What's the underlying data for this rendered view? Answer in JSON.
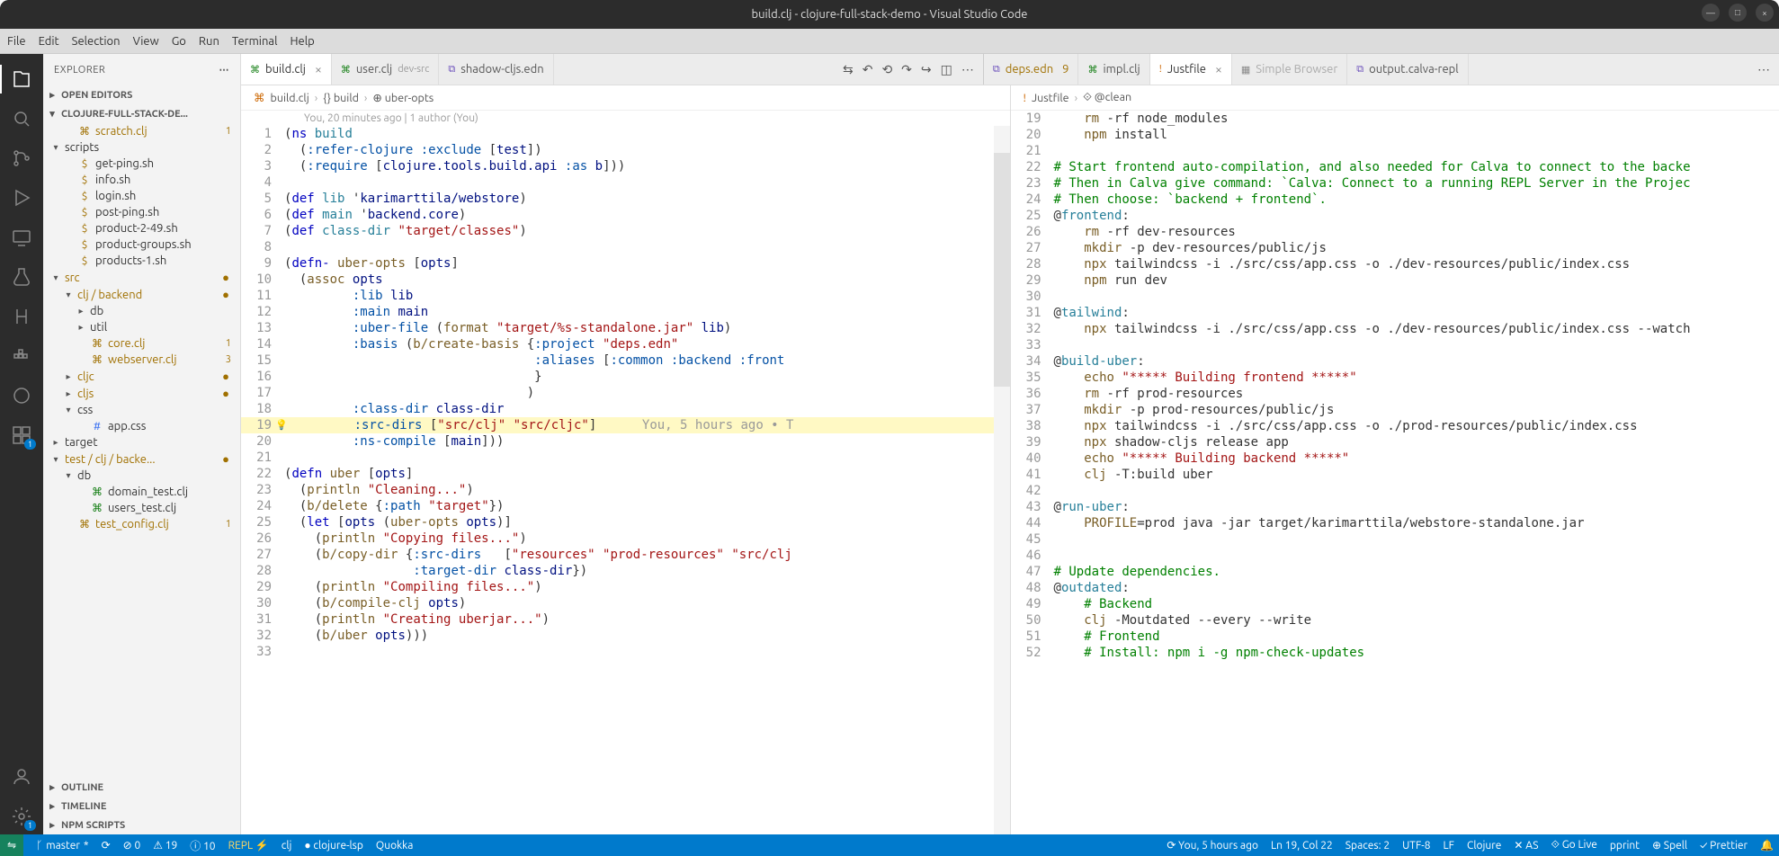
{
  "window": {
    "title": "build.clj - clojure-full-stack-demo - Visual Studio Code"
  },
  "menu": [
    "File",
    "Edit",
    "Selection",
    "View",
    "Go",
    "Run",
    "Terminal",
    "Help"
  ],
  "sidebar": {
    "title": "EXPLORER",
    "sections": {
      "open_editors": "OPEN EDITORS",
      "project": "CLOJURE-FULL-STACK-DE...",
      "outline": "OUTLINE",
      "timeline": "TIMELINE",
      "npm": "NPM SCRIPTS"
    },
    "tree": [
      {
        "depth": 1,
        "chev": "",
        "icon": "⌘",
        "iconColor": "#a07000",
        "label": "scratch.clj",
        "class": "gold",
        "badge": "1"
      },
      {
        "depth": 0,
        "chev": "▾",
        "icon": "",
        "label": "scripts"
      },
      {
        "depth": 1,
        "chev": "",
        "icon": "$",
        "iconColor": "#a07000",
        "label": "get-ping.sh"
      },
      {
        "depth": 1,
        "chev": "",
        "icon": "$",
        "iconColor": "#a07000",
        "label": "info.sh"
      },
      {
        "depth": 1,
        "chev": "",
        "icon": "$",
        "iconColor": "#a07000",
        "label": "login.sh"
      },
      {
        "depth": 1,
        "chev": "",
        "icon": "$",
        "iconColor": "#a07000",
        "label": "post-ping.sh"
      },
      {
        "depth": 1,
        "chev": "",
        "icon": "$",
        "iconColor": "#a07000",
        "label": "product-2-49.sh"
      },
      {
        "depth": 1,
        "chev": "",
        "icon": "$",
        "iconColor": "#a07000",
        "label": "product-groups.sh"
      },
      {
        "depth": 1,
        "chev": "",
        "icon": "$",
        "iconColor": "#a07000",
        "label": "products-1.sh"
      },
      {
        "depth": 0,
        "chev": "▾",
        "icon": "",
        "label": "src",
        "dot": "●",
        "class": "gold"
      },
      {
        "depth": 1,
        "chev": "▾",
        "icon": "",
        "label": "clj / backend",
        "dot": "●",
        "class": "gold"
      },
      {
        "depth": 2,
        "chev": "▸",
        "icon": "",
        "label": "db"
      },
      {
        "depth": 2,
        "chev": "▸",
        "icon": "",
        "label": "util"
      },
      {
        "depth": 2,
        "chev": "",
        "icon": "⌘",
        "iconColor": "#a07000",
        "label": "core.clj",
        "class": "gold",
        "badge": "1"
      },
      {
        "depth": 2,
        "chev": "",
        "icon": "⌘",
        "iconColor": "#a07000",
        "label": "webserver.clj",
        "class": "gold",
        "badge": "3"
      },
      {
        "depth": 1,
        "chev": "▸",
        "icon": "",
        "label": "cljc",
        "dot": "●",
        "class": "gold"
      },
      {
        "depth": 1,
        "chev": "▸",
        "icon": "",
        "label": "cljs",
        "dot": "●",
        "class": "gold"
      },
      {
        "depth": 1,
        "chev": "▾",
        "icon": "",
        "label": "css"
      },
      {
        "depth": 2,
        "chev": "",
        "icon": "#",
        "iconColor": "#2965f1",
        "label": "app.css"
      },
      {
        "depth": 0,
        "chev": "▸",
        "icon": "",
        "label": "target"
      },
      {
        "depth": 0,
        "chev": "▾",
        "icon": "",
        "label": "test / clj / backe...",
        "dot": "●",
        "class": "gold"
      },
      {
        "depth": 1,
        "chev": "▾",
        "icon": "",
        "label": "db"
      },
      {
        "depth": 2,
        "chev": "",
        "icon": "⌘",
        "iconColor": "#107c10",
        "label": "domain_test.clj"
      },
      {
        "depth": 2,
        "chev": "",
        "icon": "⌘",
        "iconColor": "#107c10",
        "label": "users_test.clj"
      },
      {
        "depth": 1,
        "chev": "",
        "icon": "⌘",
        "iconColor": "#a07000",
        "label": "test_config.clj",
        "class": "gold",
        "badge": "1"
      }
    ]
  },
  "tabsLeft": [
    {
      "icon": "⌘",
      "iconColor": "#107c10",
      "label": "build.clj",
      "active": true,
      "close": "×"
    },
    {
      "icon": "⌘",
      "iconColor": "#107c10",
      "label": "user.clj",
      "suffix": "dev-src"
    },
    {
      "icon": "⧉",
      "iconColor": "#6b4fbb",
      "label": "shadow-cljs.edn"
    }
  ],
  "tabsRight": [
    {
      "icon": "⧉",
      "iconColor": "#6b4fbb",
      "label": "deps.edn",
      "badge": "9",
      "class": "gold"
    },
    {
      "icon": "⌘",
      "iconColor": "#107c10",
      "label": "impl.clj"
    },
    {
      "icon": "!",
      "iconColor": "#cc6600",
      "label": "Justfile",
      "active": true,
      "close": "×"
    },
    {
      "icon": "▦",
      "iconColor": "#888",
      "label": "Simple Browser",
      "dim": true
    },
    {
      "icon": "⧉",
      "iconColor": "#6b4fbb",
      "label": "output.calva-repl"
    }
  ],
  "breadcrumbLeft": [
    "build.clj",
    "{} build",
    "⊕ uber-opts"
  ],
  "breadcrumbRight": [
    "Justfile",
    "⟐ @clean"
  ],
  "blame": "You, 20 minutes ago | 1 author (You)",
  "editorLeft": [
    {
      "n": 1,
      "t": "(<kw>ns</kw> <def>build</def>"
    },
    {
      "n": 2,
      "t": "  (<key>:refer-clojure</key> <key>:exclude</key> [<sym>test</sym>])"
    },
    {
      "n": 3,
      "t": "  (<key>:require</key> [<sym>clojure.tools.build.api</sym> <key>:as</key> <sym>b</sym>]))"
    },
    {
      "n": 4,
      "t": ""
    },
    {
      "n": 5,
      "t": "(<kw>def</kw> <def>lib</def> '<sym>karimarttila/webstore</sym>)"
    },
    {
      "n": 6,
      "t": "(<kw>def</kw> <def>main</def> '<sym>backend.core</sym>)"
    },
    {
      "n": 7,
      "t": "(<kw>def</kw> <def>class-dir</def> <str>\"target/classes\"</str>)"
    },
    {
      "n": 8,
      "t": ""
    },
    {
      "n": 9,
      "t": "(<kw>defn-</kw> <fn>uber-opts</fn> [<sym>opts</sym>]"
    },
    {
      "n": 10,
      "t": "  (<fn>assoc</fn> <sym>opts</sym>"
    },
    {
      "n": 11,
      "t": "         <key>:lib</key> <sym>lib</sym>"
    },
    {
      "n": 12,
      "t": "         <key>:main</key> <sym>main</sym>"
    },
    {
      "n": 13,
      "t": "         <key>:uber-file</key> (<fn>format</fn> <str>\"target/%s-standalone.jar\"</str> <sym>lib</sym>)"
    },
    {
      "n": 14,
      "t": "         <key>:basis</key> (<fn>b/create-basis</fn> {<key>:project</key> <str>\"deps.edn\"</str>"
    },
    {
      "n": 15,
      "t": "                                 <key>:aliases</key> [<key>:common</key> <key>:backend</key> <key>:front</key>"
    },
    {
      "n": 16,
      "t": "                                 }"
    },
    {
      "n": 17,
      "t": "                                )"
    },
    {
      "n": 18,
      "t": "         <key>:class-dir</key> <sym>class-dir</sym>"
    },
    {
      "n": 19,
      "hl": true,
      "bulb": true,
      "t": "         <key>:src-dirs</key> [<str>\"src/clj\"</str> <str>\"src/cljc\"</str>]      <ann>You, 5 hours ago • T</ann>"
    },
    {
      "n": 20,
      "t": "         <key>:ns-compile</key> [<sym>main</sym>]))"
    },
    {
      "n": 21,
      "t": ""
    },
    {
      "n": 22,
      "t": "(<kw>defn</kw> <fn>uber</fn> [<sym>opts</sym>]"
    },
    {
      "n": 23,
      "t": "  (<fn>println</fn> <str>\"Cleaning...\"</str>)"
    },
    {
      "n": 24,
      "t": "  (<fn>b/delete</fn> {<key>:path</key> <str>\"target\"</str>})"
    },
    {
      "n": 25,
      "t": "  (<kw>let</kw> [<sym>opts</sym> (<fn>uber-opts</fn> <sym>opts</sym>)]"
    },
    {
      "n": 26,
      "t": "    (<fn>println</fn> <str>\"Copying files...\"</str>)"
    },
    {
      "n": 27,
      "t": "    (<fn>b/copy-dir</fn> {<key>:src-dirs</key>   [<str>\"resources\"</str> <str>\"prod-resources\"</str> <str>\"src/clj</str>"
    },
    {
      "n": 28,
      "t": "                 <key>:target-dir</key> <sym>class-dir</sym>})"
    },
    {
      "n": 29,
      "t": "    (<fn>println</fn> <str>\"Compiling files...\"</str>)"
    },
    {
      "n": 30,
      "t": "    (<fn>b/compile-clj</fn> <sym>opts</sym>)"
    },
    {
      "n": 31,
      "t": "    (<fn>println</fn> <str>\"Creating uberjar...\"</str>)"
    },
    {
      "n": 32,
      "t": "    (<fn>b/uber</fn> <sym>opts</sym>)))"
    },
    {
      "n": 33,
      "t": ""
    }
  ],
  "editorRight": [
    {
      "n": 19,
      "t": "    <fn>rm</fn> -rf node_modules"
    },
    {
      "n": 20,
      "t": "    <fn>npm</fn> install"
    },
    {
      "n": 21,
      "t": ""
    },
    {
      "n": 22,
      "t": "<com># Start frontend auto-compilation, and also needed for Calva to connect to the backe</com>"
    },
    {
      "n": 23,
      "t": "<com># Then in Calva give command: `Calva: Connect to a running REPL Server in the Projec</com>"
    },
    {
      "n": 24,
      "t": "<com># Then choose: `backend + frontend`.</com>"
    },
    {
      "n": 25,
      "t": "@<def>frontend</def>:"
    },
    {
      "n": 26,
      "t": "    <fn>rm</fn> -rf dev-resources"
    },
    {
      "n": 27,
      "t": "    <fn>mkdir</fn> -p dev-resources/public/js"
    },
    {
      "n": 28,
      "t": "    <fn>npx</fn> tailwindcss -i ./src/css/app.css -o ./dev-resources/public/index.css"
    },
    {
      "n": 29,
      "t": "    <fn>npm</fn> run dev"
    },
    {
      "n": 30,
      "t": ""
    },
    {
      "n": 31,
      "t": "@<def>tailwind</def>:"
    },
    {
      "n": 32,
      "t": "    <fn>npx</fn> tailwindcss -i ./src/css/app.css -o ./dev-resources/public/index.css --watch"
    },
    {
      "n": 33,
      "t": ""
    },
    {
      "n": 34,
      "t": "@<def>build-uber</def>:"
    },
    {
      "n": 35,
      "t": "    <fn>echo</fn> <str>\"***** Building frontend *****\"</str>"
    },
    {
      "n": 36,
      "t": "    <fn>rm</fn> -rf prod-resources"
    },
    {
      "n": 37,
      "t": "    <fn>mkdir</fn> -p prod-resources/public/js"
    },
    {
      "n": 38,
      "t": "    <fn>npx</fn> tailwindcss -i ./src/css/app.css -o ./prod-resources/public/index.css"
    },
    {
      "n": 39,
      "t": "    <fn>npx</fn> shadow-cljs release app"
    },
    {
      "n": 40,
      "t": "    <fn>echo</fn> <str>\"***** Building backend *****\"</str>"
    },
    {
      "n": 41,
      "t": "    <fn>clj</fn> -T:build uber"
    },
    {
      "n": 42,
      "t": ""
    },
    {
      "n": 43,
      "t": "@<def>run-uber</def>:"
    },
    {
      "n": 44,
      "t": "    <fn>PROFILE</fn>=prod java -jar target/karimarttila/webstore-standalone.jar"
    },
    {
      "n": 45,
      "t": ""
    },
    {
      "n": 46,
      "t": ""
    },
    {
      "n": 47,
      "t": "<com># Update dependencies.</com>"
    },
    {
      "n": 48,
      "t": "@<def>outdated</def>:"
    },
    {
      "n": 49,
      "t": "    <com># Backend</com>"
    },
    {
      "n": 50,
      "t": "    <fn>clj</fn> -Moutdated --every --write"
    },
    {
      "n": 51,
      "t": "    <com># Frontend</com>"
    },
    {
      "n": 52,
      "t": "    <com># Install: npm i -g npm-check-updates</com>"
    }
  ],
  "status": {
    "remote": "⇋",
    "branch": "master",
    "sync": "⟳",
    "errors": "⊘ 0",
    "warnings": "⚠ 19",
    "info": "ⓘ 10",
    "repl": "REPL ⚡",
    "lang1": "clj",
    "lsp": "● clojure-lsp",
    "quokka": "Quokka",
    "blame": "⟳ You, 5 hours ago",
    "pos": "Ln 19, Col 22",
    "spaces": "Spaces: 2",
    "enc": "UTF-8",
    "eol": "LF",
    "mode": "Clojure",
    "as": "✕ AS",
    "golive": "⟐ Go Live",
    "pprint": "pprint",
    "spell": "⊕ Spell",
    "prettier": "✓ Prettier",
    "bell": "🔔"
  }
}
